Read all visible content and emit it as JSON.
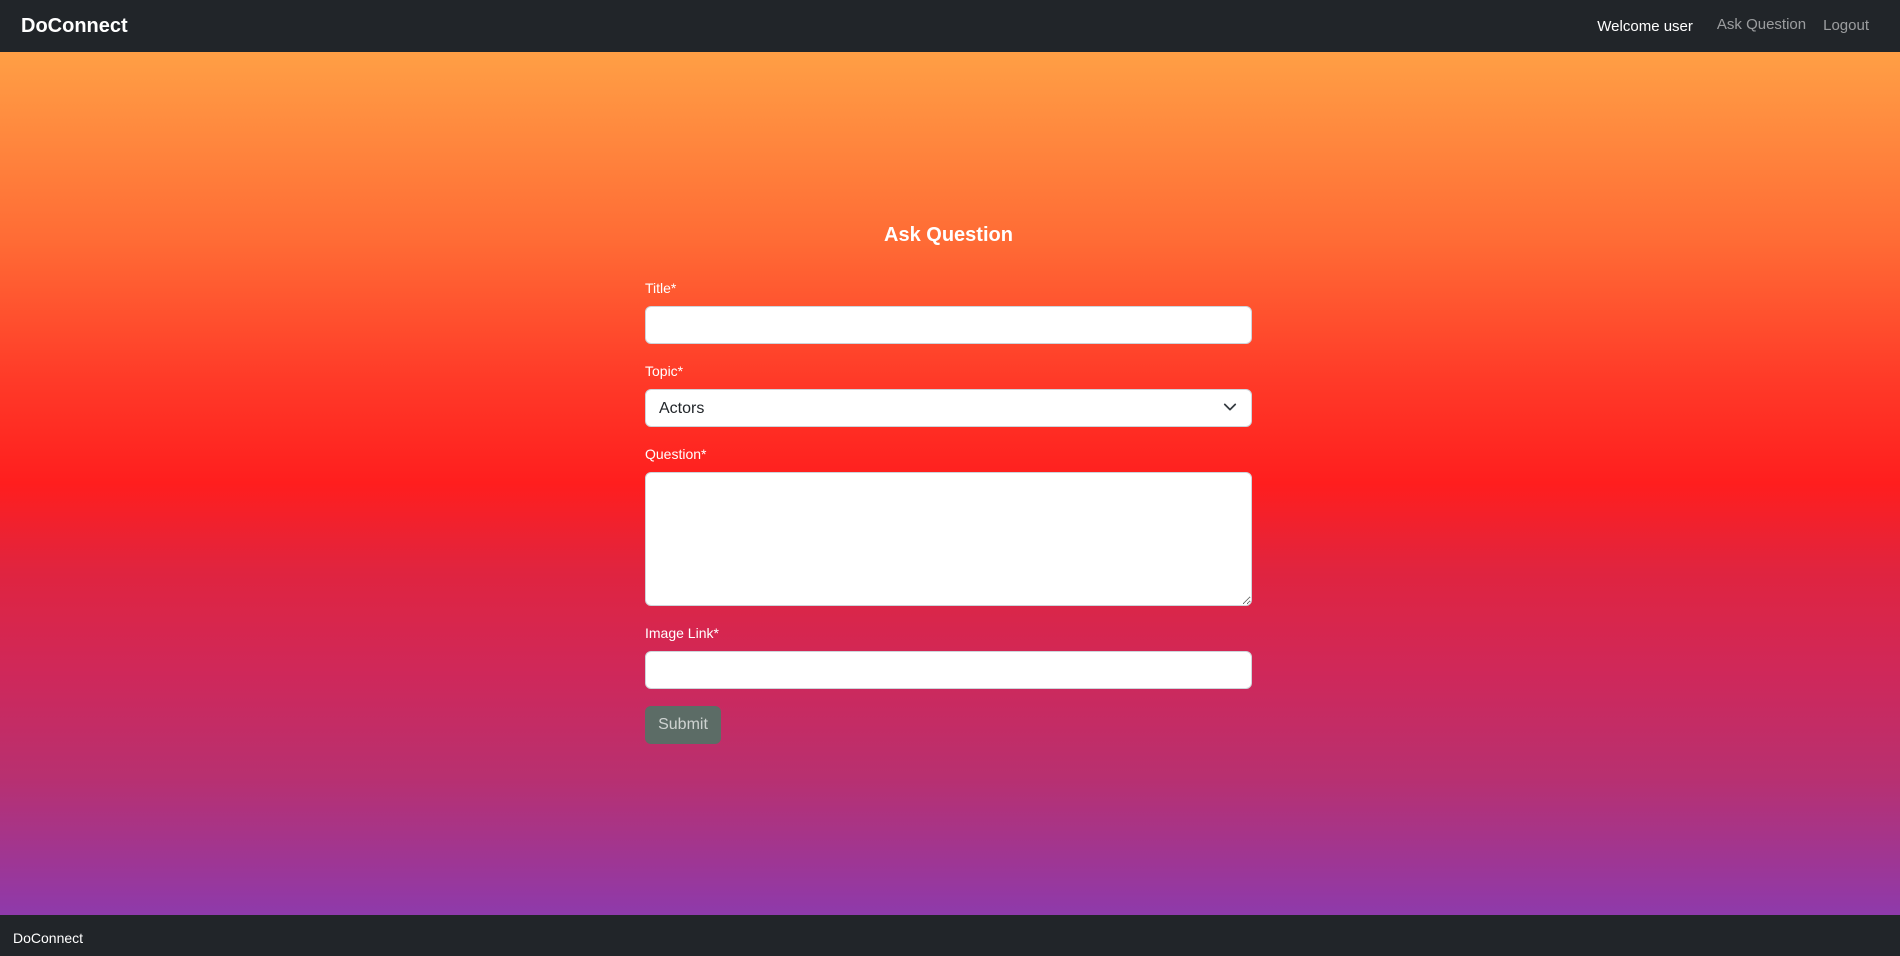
{
  "navbar": {
    "brand": "DoConnect",
    "welcome": "Welcome user",
    "ask_question": "Ask Question",
    "logout": "Logout"
  },
  "form": {
    "title": "Ask Question",
    "title_label": "Title*",
    "title_value": "",
    "topic_label": "Topic*",
    "topic_value": "Actors",
    "question_label": "Question*",
    "question_value": "",
    "image_label": "Image Link*",
    "image_value": "",
    "submit": "Submit"
  },
  "footer": {
    "text": "DoConnect"
  },
  "colors": {
    "navbar_bg": "#212529",
    "gradient_top": "#ff9f45",
    "gradient_mid": "#ff1e1e",
    "gradient_bottom": "#8e3aab",
    "submit_bg": "#5c6c66"
  },
  "icons": {
    "select_chevron": "chevron-down-icon"
  }
}
